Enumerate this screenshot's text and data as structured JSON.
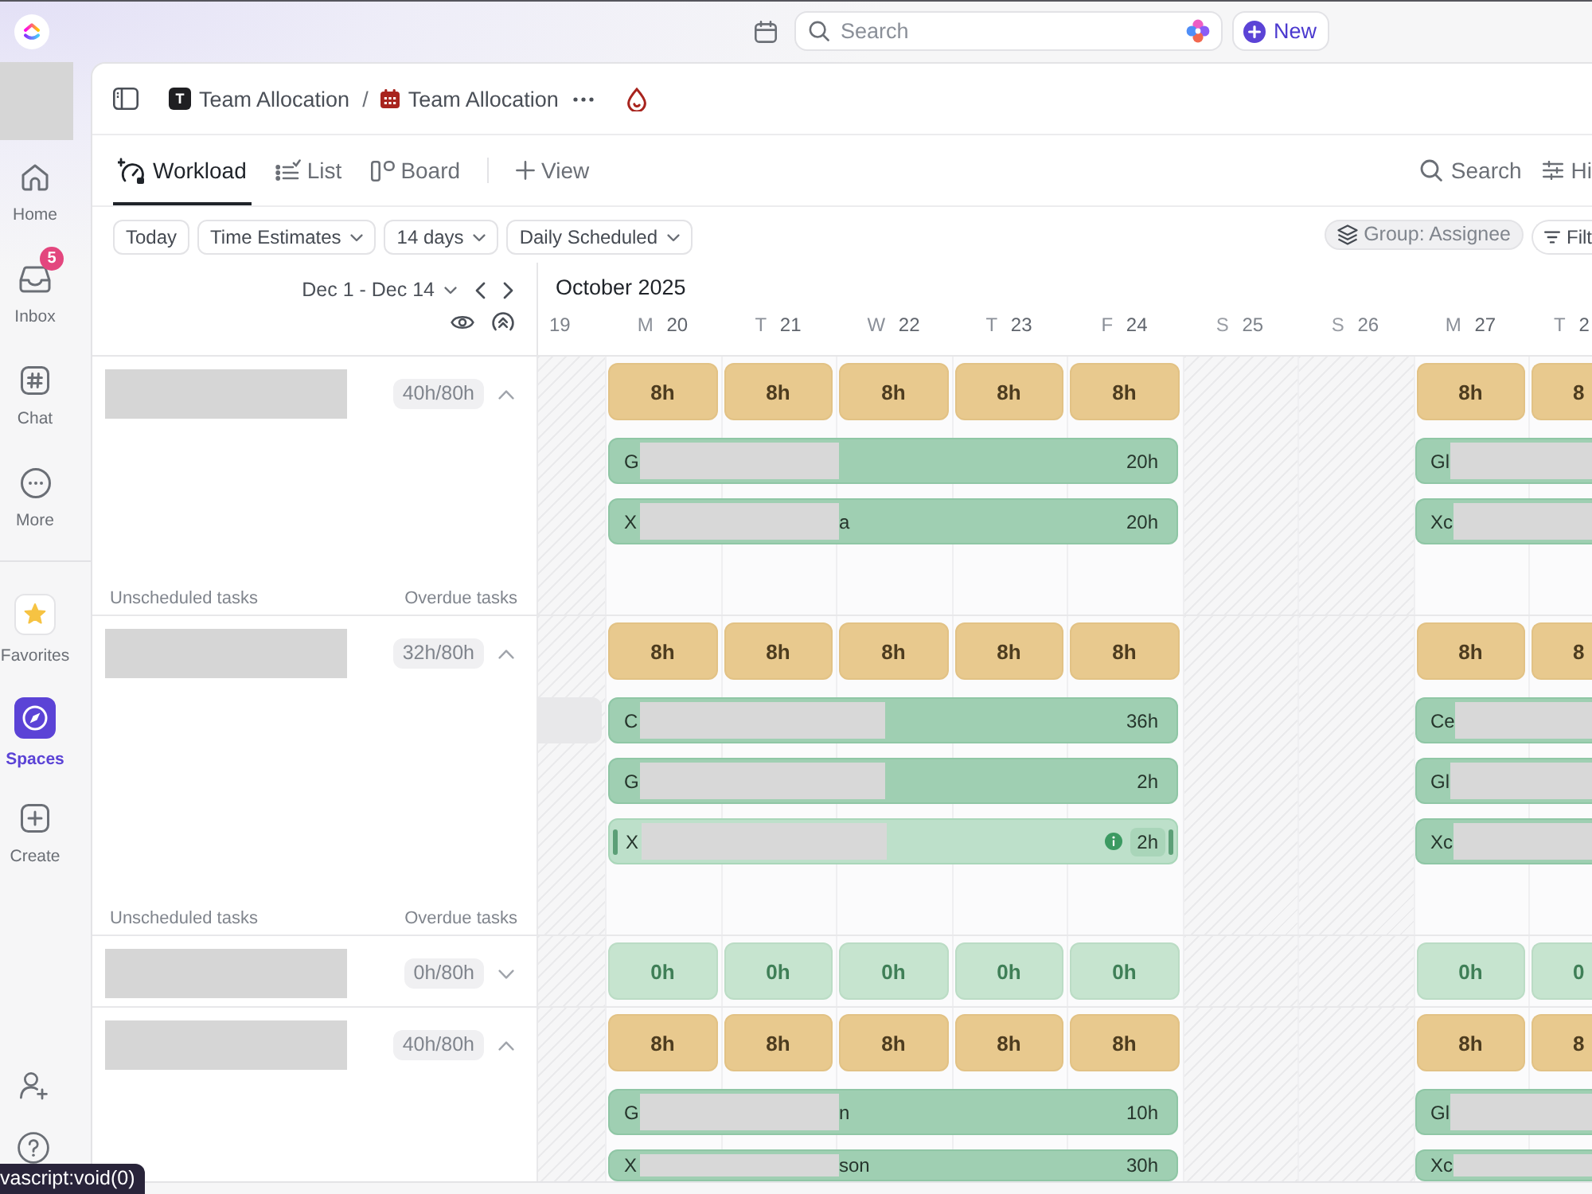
{
  "top_bar": {
    "search": {
      "placeholder": "Search"
    },
    "new_button": {
      "label": "New"
    }
  },
  "sidebar": {
    "sections": [
      {
        "items": [
          {
            "label": "Home",
            "selected": false
          },
          {
            "label": "Inbox",
            "selected": false,
            "badge": "5"
          },
          {
            "label": "Chat",
            "selected": false
          },
          {
            "label": "More",
            "selected": false
          }
        ]
      },
      {
        "items": [
          {
            "label": "Favorites",
            "selected": false
          },
          {
            "label": "Spaces",
            "selected": true
          },
          {
            "label": "Create",
            "selected": false
          }
        ]
      }
    ]
  },
  "breadcrumb": {
    "items": [
      {
        "avatar": "T",
        "label": "Team Allocation"
      },
      {
        "label": "Team Allocation"
      }
    ],
    "separator": "/"
  },
  "view_tabs": {
    "tabs": [
      {
        "label": "Workload",
        "selected": true
      },
      {
        "label": "List",
        "selected": false
      },
      {
        "label": "Board",
        "selected": false
      }
    ],
    "add_view": "View",
    "search": "Search",
    "hide": "Hi"
  },
  "toolbar": {
    "buttons": [
      {
        "label": "Today",
        "dropdown": false
      },
      {
        "label": "Time Estimates",
        "dropdown": true
      },
      {
        "label": "14 days",
        "dropdown": true
      },
      {
        "label": "Daily Scheduled",
        "dropdown": true
      }
    ],
    "group_by": "Group: Assignee",
    "filter": "Filt"
  },
  "timeline": {
    "range": "Dec 1 - Dec 14",
    "month": "October 2025",
    "days": [
      {
        "date": "19",
        "off": true
      },
      {
        "letter": "M",
        "date": "20",
        "off": false
      },
      {
        "letter": "T",
        "date": "21",
        "off": false
      },
      {
        "letter": "W",
        "date": "22",
        "off": false
      },
      {
        "letter": "T",
        "date": "23",
        "off": false
      },
      {
        "letter": "F",
        "date": "24",
        "off": false
      },
      {
        "letter": "S",
        "date": "25",
        "off": true
      },
      {
        "letter": "S",
        "date": "26",
        "off": true
      },
      {
        "letter": "M",
        "date": "27",
        "off": false
      },
      {
        "letter": "T",
        "date": "2",
        "off": false
      }
    ]
  },
  "groups": [
    {
      "load": "40h/80h",
      "expanded": true,
      "available": false,
      "capacity": [
        "8h",
        "8h",
        "8h",
        "8h",
        "8h",
        "8h",
        "8"
      ],
      "tasks": [
        {
          "segments": [
            {
              "kind": "current",
              "lead": "G",
              "hours": "20h",
              "selected": false
            },
            {
              "kind": "next",
              "lead": "Gl",
              "selected": false
            }
          ]
        },
        {
          "segments": [
            {
              "kind": "current",
              "lead": "X",
              "tail": "a",
              "hours": "20h",
              "selected": false
            },
            {
              "kind": "next",
              "lead": "Xc",
              "selected": false
            }
          ]
        }
      ],
      "footer": {
        "unscheduled": "Unscheduled tasks",
        "overdue": "Overdue tasks"
      }
    },
    {
      "load": "32h/80h",
      "expanded": true,
      "available": false,
      "capacity": [
        "8h",
        "8h",
        "8h",
        "8h",
        "8h",
        "8h",
        "8"
      ],
      "tasks": [
        {
          "segments": [
            {
              "kind": "previous",
              "selected": false
            },
            {
              "kind": "current",
              "lead": "C",
              "hours": "36h",
              "selected": false
            },
            {
              "kind": "next",
              "lead": "Ce",
              "selected": false
            }
          ]
        },
        {
          "segments": [
            {
              "kind": "current",
              "lead": "G",
              "hours": "2h",
              "selected": false
            },
            {
              "kind": "next",
              "lead": "Gl",
              "selected": false
            }
          ]
        },
        {
          "segments": [
            {
              "kind": "current",
              "lead": "X",
              "hours": "2h",
              "selected": true
            },
            {
              "kind": "next",
              "lead": "Xc",
              "selected": false
            }
          ]
        }
      ],
      "footer": {
        "unscheduled": "Unscheduled tasks",
        "overdue": "Overdue tasks"
      }
    },
    {
      "load": "0h/80h",
      "expanded": false,
      "available": true,
      "capacity": [
        "0h",
        "0h",
        "0h",
        "0h",
        "0h",
        "0h",
        "0"
      ]
    },
    {
      "load": "40h/80h",
      "expanded": true,
      "available": false,
      "capacity": [
        "8h",
        "8h",
        "8h",
        "8h",
        "8h",
        "8h",
        "8"
      ],
      "tasks": [
        {
          "segments": [
            {
              "kind": "current",
              "lead": "G",
              "tail": "n",
              "hours": "10h",
              "selected": false
            },
            {
              "kind": "next",
              "lead": "Gl",
              "selected": false
            }
          ]
        },
        {
          "segments": [
            {
              "kind": "current",
              "lead": "X",
              "tail": "son",
              "hours": "30h",
              "selected": false
            },
            {
              "kind": "next",
              "lead": "Xc",
              "selected": false
            }
          ]
        }
      ]
    }
  ],
  "status_tooltip": "vascript:void(0)"
}
